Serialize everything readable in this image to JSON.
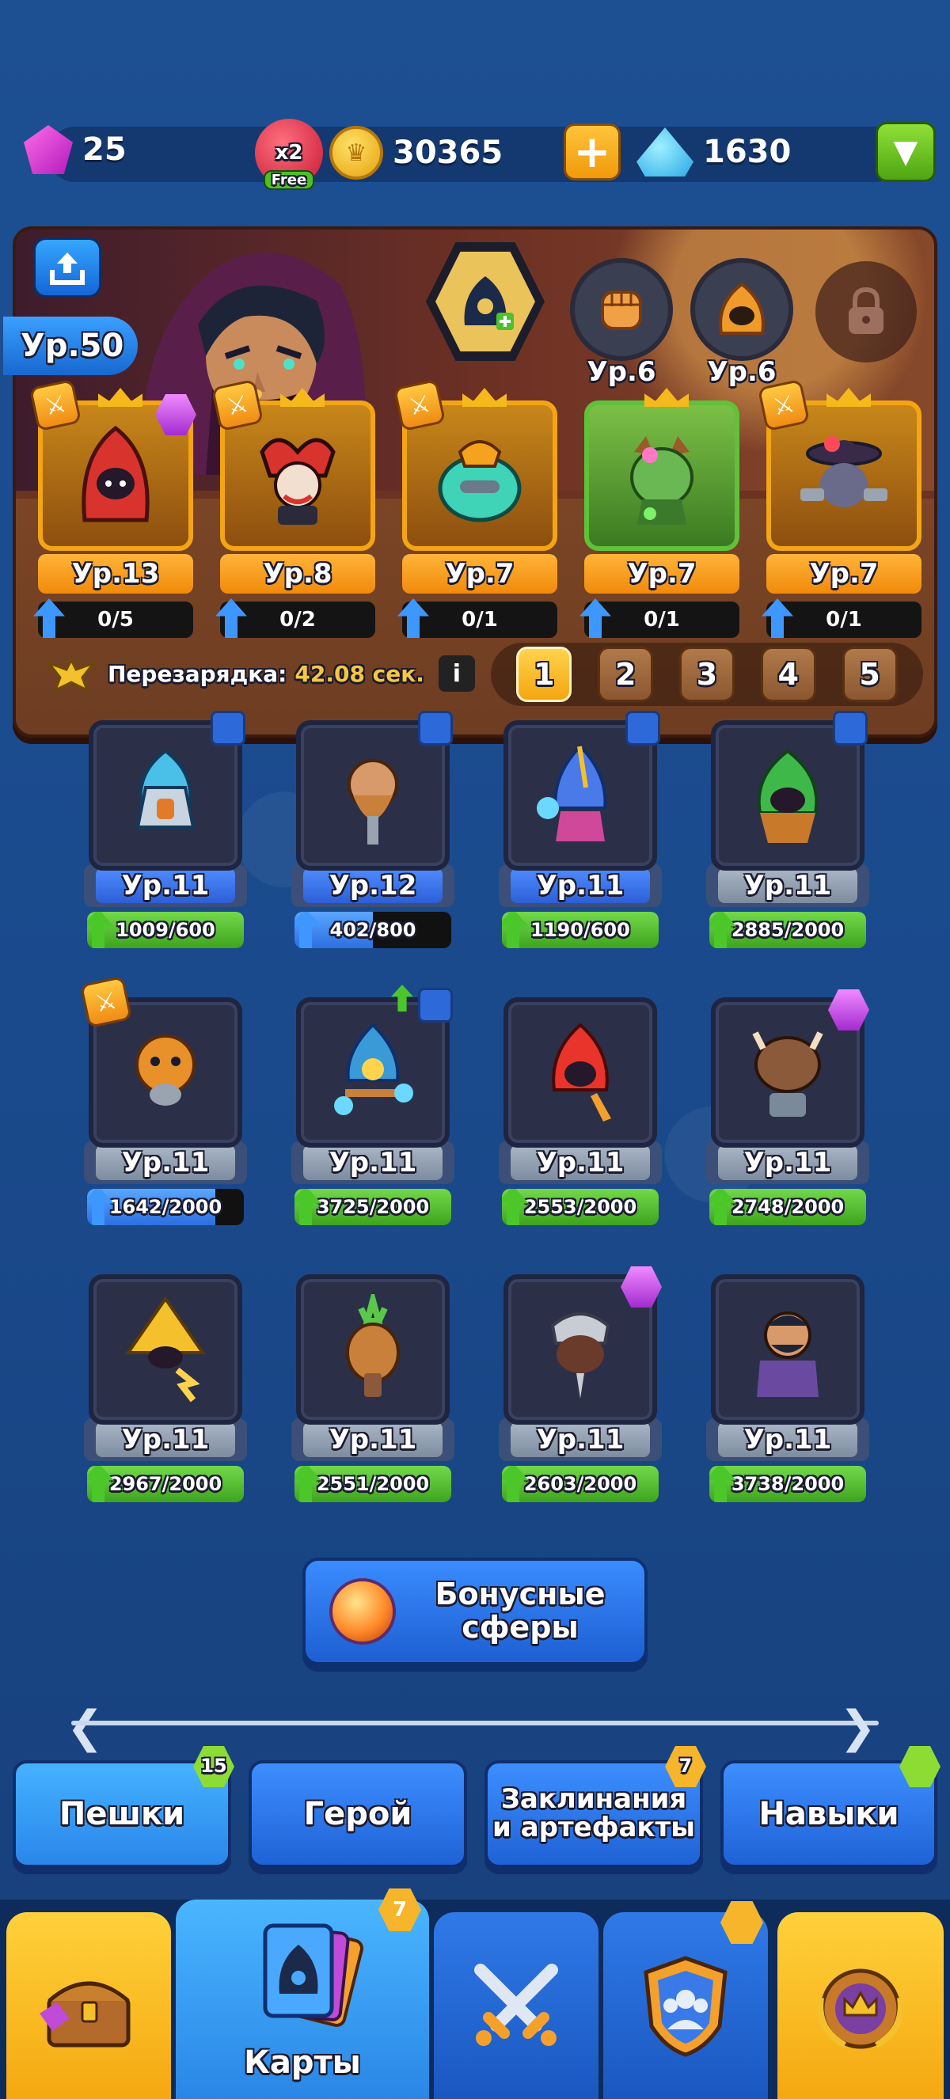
{
  "resources": {
    "gems": "25",
    "boost_label": "x2",
    "boost_free": "Free",
    "coins": "30365",
    "crystals": "1630"
  },
  "hero": {
    "level": "Ур.50",
    "slot1_level": "Ур.6",
    "slot2_level": "Ур.6"
  },
  "equipped": [
    {
      "level": "Ур.13",
      "progress": "0/5"
    },
    {
      "level": "Ур.8",
      "progress": "0/2"
    },
    {
      "level": "Ур.7",
      "progress": "0/1"
    },
    {
      "level": "Ур.7",
      "progress": "0/1"
    },
    {
      "level": "Ур.7",
      "progress": "0/1"
    }
  ],
  "cooldown": {
    "label": "Перезарядка:",
    "time": "42.08 сек."
  },
  "decks": [
    "1",
    "2",
    "3",
    "4",
    "5"
  ],
  "collection": [
    {
      "level": "Ур.11",
      "progress": "1009/600",
      "fill": 1.0,
      "style": "blue"
    },
    {
      "level": "Ур.12",
      "progress": "402/800",
      "fill": 0.5,
      "style": "blue"
    },
    {
      "level": "Ур.11",
      "progress": "1190/600",
      "fill": 1.0,
      "style": "blue"
    },
    {
      "level": "Ур.11",
      "progress": "2885/2000",
      "fill": 1.0,
      "style": "grey"
    },
    {
      "level": "Ур.11",
      "progress": "1642/2000",
      "fill": 0.82,
      "style": "grey"
    },
    {
      "level": "Ур.11",
      "progress": "3725/2000",
      "fill": 1.0,
      "style": "grey"
    },
    {
      "level": "Ур.11",
      "progress": "2553/2000",
      "fill": 1.0,
      "style": "grey"
    },
    {
      "level": "Ур.11",
      "progress": "2748/2000",
      "fill": 1.0,
      "style": "grey"
    },
    {
      "level": "Ур.11",
      "progress": "2967/2000",
      "fill": 1.0,
      "style": "grey"
    },
    {
      "level": "Ур.11",
      "progress": "2551/2000",
      "fill": 1.0,
      "style": "grey"
    },
    {
      "level": "Ур.11",
      "progress": "2603/2000",
      "fill": 1.0,
      "style": "grey"
    },
    {
      "level": "Ур.11",
      "progress": "3738/2000",
      "fill": 1.0,
      "style": "grey"
    }
  ],
  "bonus": {
    "line1": "Бонусные",
    "line2": "сферы"
  },
  "tabs": {
    "pawns": "Пешки",
    "pawns_count": "15",
    "hero": "Герой",
    "spells_line1": "Заклинания",
    "spells_line2": "и артефакты",
    "spells_count": "7",
    "skills": "Навыки"
  },
  "nav": {
    "cards_label": "Карты",
    "cards_badge": "7"
  }
}
